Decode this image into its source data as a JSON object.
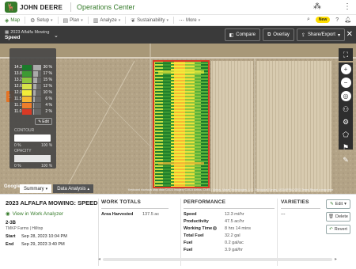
{
  "header": {
    "brand": "JOHN DEERE",
    "app_title": "Operations Center",
    "icons": [
      "apps-icon",
      "more-vert-icon"
    ]
  },
  "nav": {
    "items": [
      {
        "label": "Map",
        "icon": "map-icon",
        "active": true
      },
      {
        "label": "Setup",
        "icon": "setup-icon"
      },
      {
        "label": "Plan",
        "icon": "plan-icon"
      },
      {
        "label": "Analyze",
        "icon": "analyze-icon"
      },
      {
        "label": "Sustainability",
        "icon": "sustainability-icon"
      },
      {
        "label": "More",
        "icon": "more-icon"
      }
    ],
    "new_badge": "New"
  },
  "toolbar": {
    "layer_sub": "2023 Alfalfa Mowing",
    "layer_main": "Speed",
    "compare_label": "Compare",
    "overlay_label": "Overlay",
    "share_label": "Share/Export"
  },
  "legend": {
    "tag": "1",
    "rows": [
      {
        "value": "14.3",
        "color": "#1a7a2a",
        "pct": "30 %",
        "frac": 0.3
      },
      {
        "value": "13.8",
        "color": "#3d9a33",
        "pct": "17 %",
        "frac": 0.17
      },
      {
        "value": "13.2",
        "color": "#8ec63f",
        "pct": "15 %",
        "frac": 0.15
      },
      {
        "value": "12.6",
        "color": "#d7e34a",
        "pct": "12 %",
        "frac": 0.12
      },
      {
        "value": "12.0",
        "color": "#f2ec3a",
        "pct": "10 %",
        "frac": 0.1
      },
      {
        "value": "11.5",
        "color": "#f7b733",
        "pct": "6 %",
        "frac": 0.06
      },
      {
        "value": "11.1",
        "color": "#ee7d2b",
        "pct": "4 %",
        "frac": 0.04
      },
      {
        "value": "11.0",
        "color": "#d93a25",
        "pct": "2 %",
        "frac": 0.02
      }
    ],
    "edit_label": "Edit",
    "contour_label": "CONTOUR",
    "contour_min": "0 %",
    "contour_max": "100 %",
    "opacity_label": "OPACITY",
    "opacity_min": "0 %",
    "opacity_max": "100 %"
  },
  "map": {
    "google": "Google",
    "attribution": "Keyboard shortcuts   Map data ©2023 Imagery ©2023 Airbus, CNES / Airbus, Maxar Technologies, U.S. Geological Survey, USDA/FPAC/GEO   Terms   Report a map error"
  },
  "bottom_tabs": [
    "Summary",
    "Data Analysis"
  ],
  "details": {
    "title": "2023 ALFALFA MOWING: SPEED",
    "view_link": "View in Work Analyzer",
    "field": "2-3B",
    "farm": "TMKP Farms | Hilltop",
    "start_label": "Start",
    "start_value": "Sep 28, 2023 10:04 PM",
    "end_label": "End",
    "end_value": "Sep 29, 2023 3:40 PM",
    "work_totals_title": "WORK TOTALS",
    "area_harvested_label": "Area Harvested",
    "area_harvested_value": "137.5 ac",
    "performance_title": "PERFORMANCE",
    "performance": [
      {
        "label": "Speed",
        "value": "12.3 mi/hr"
      },
      {
        "label": "Productivity",
        "value": "47.5 ac/hr"
      },
      {
        "label": "Working Time",
        "value": "8 hrs 14 mins",
        "help": true
      },
      {
        "label": "Total Fuel",
        "value": "32.2 gal"
      },
      {
        "label": "Fuel",
        "value": "0.2 gal/ac"
      },
      {
        "label": "Fuel",
        "value": "3.9 gal/hr"
      }
    ],
    "varieties_title": "VARIETIES",
    "varieties_value": "---",
    "edit_label": "Edit",
    "delete_label": "Delete",
    "revert_label": "Revert"
  }
}
